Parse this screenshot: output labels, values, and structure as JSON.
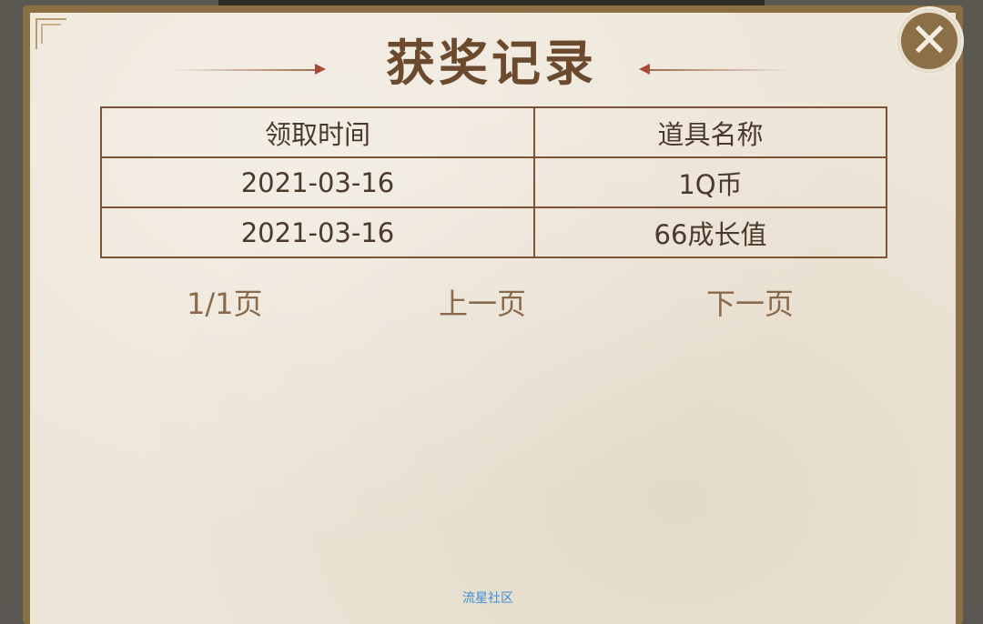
{
  "dialog": {
    "title": "获奖记录",
    "close_icon": "close-icon"
  },
  "table": {
    "headers": [
      "领取时间",
      "道具名称"
    ],
    "rows": [
      [
        "2021-03-16",
        "1Q币"
      ],
      [
        "2021-03-16",
        "66成长值"
      ]
    ]
  },
  "pagination": {
    "page_indicator": "1/1页",
    "prev_label": "上一页",
    "next_label": "下一页"
  },
  "watermark": "流星社区",
  "colors": {
    "frame": "#8a6f45",
    "paper": "#ede5d8",
    "title": "#6b4a2e",
    "table_border": "#7a5434",
    "pager_text": "#8a6a4c"
  }
}
